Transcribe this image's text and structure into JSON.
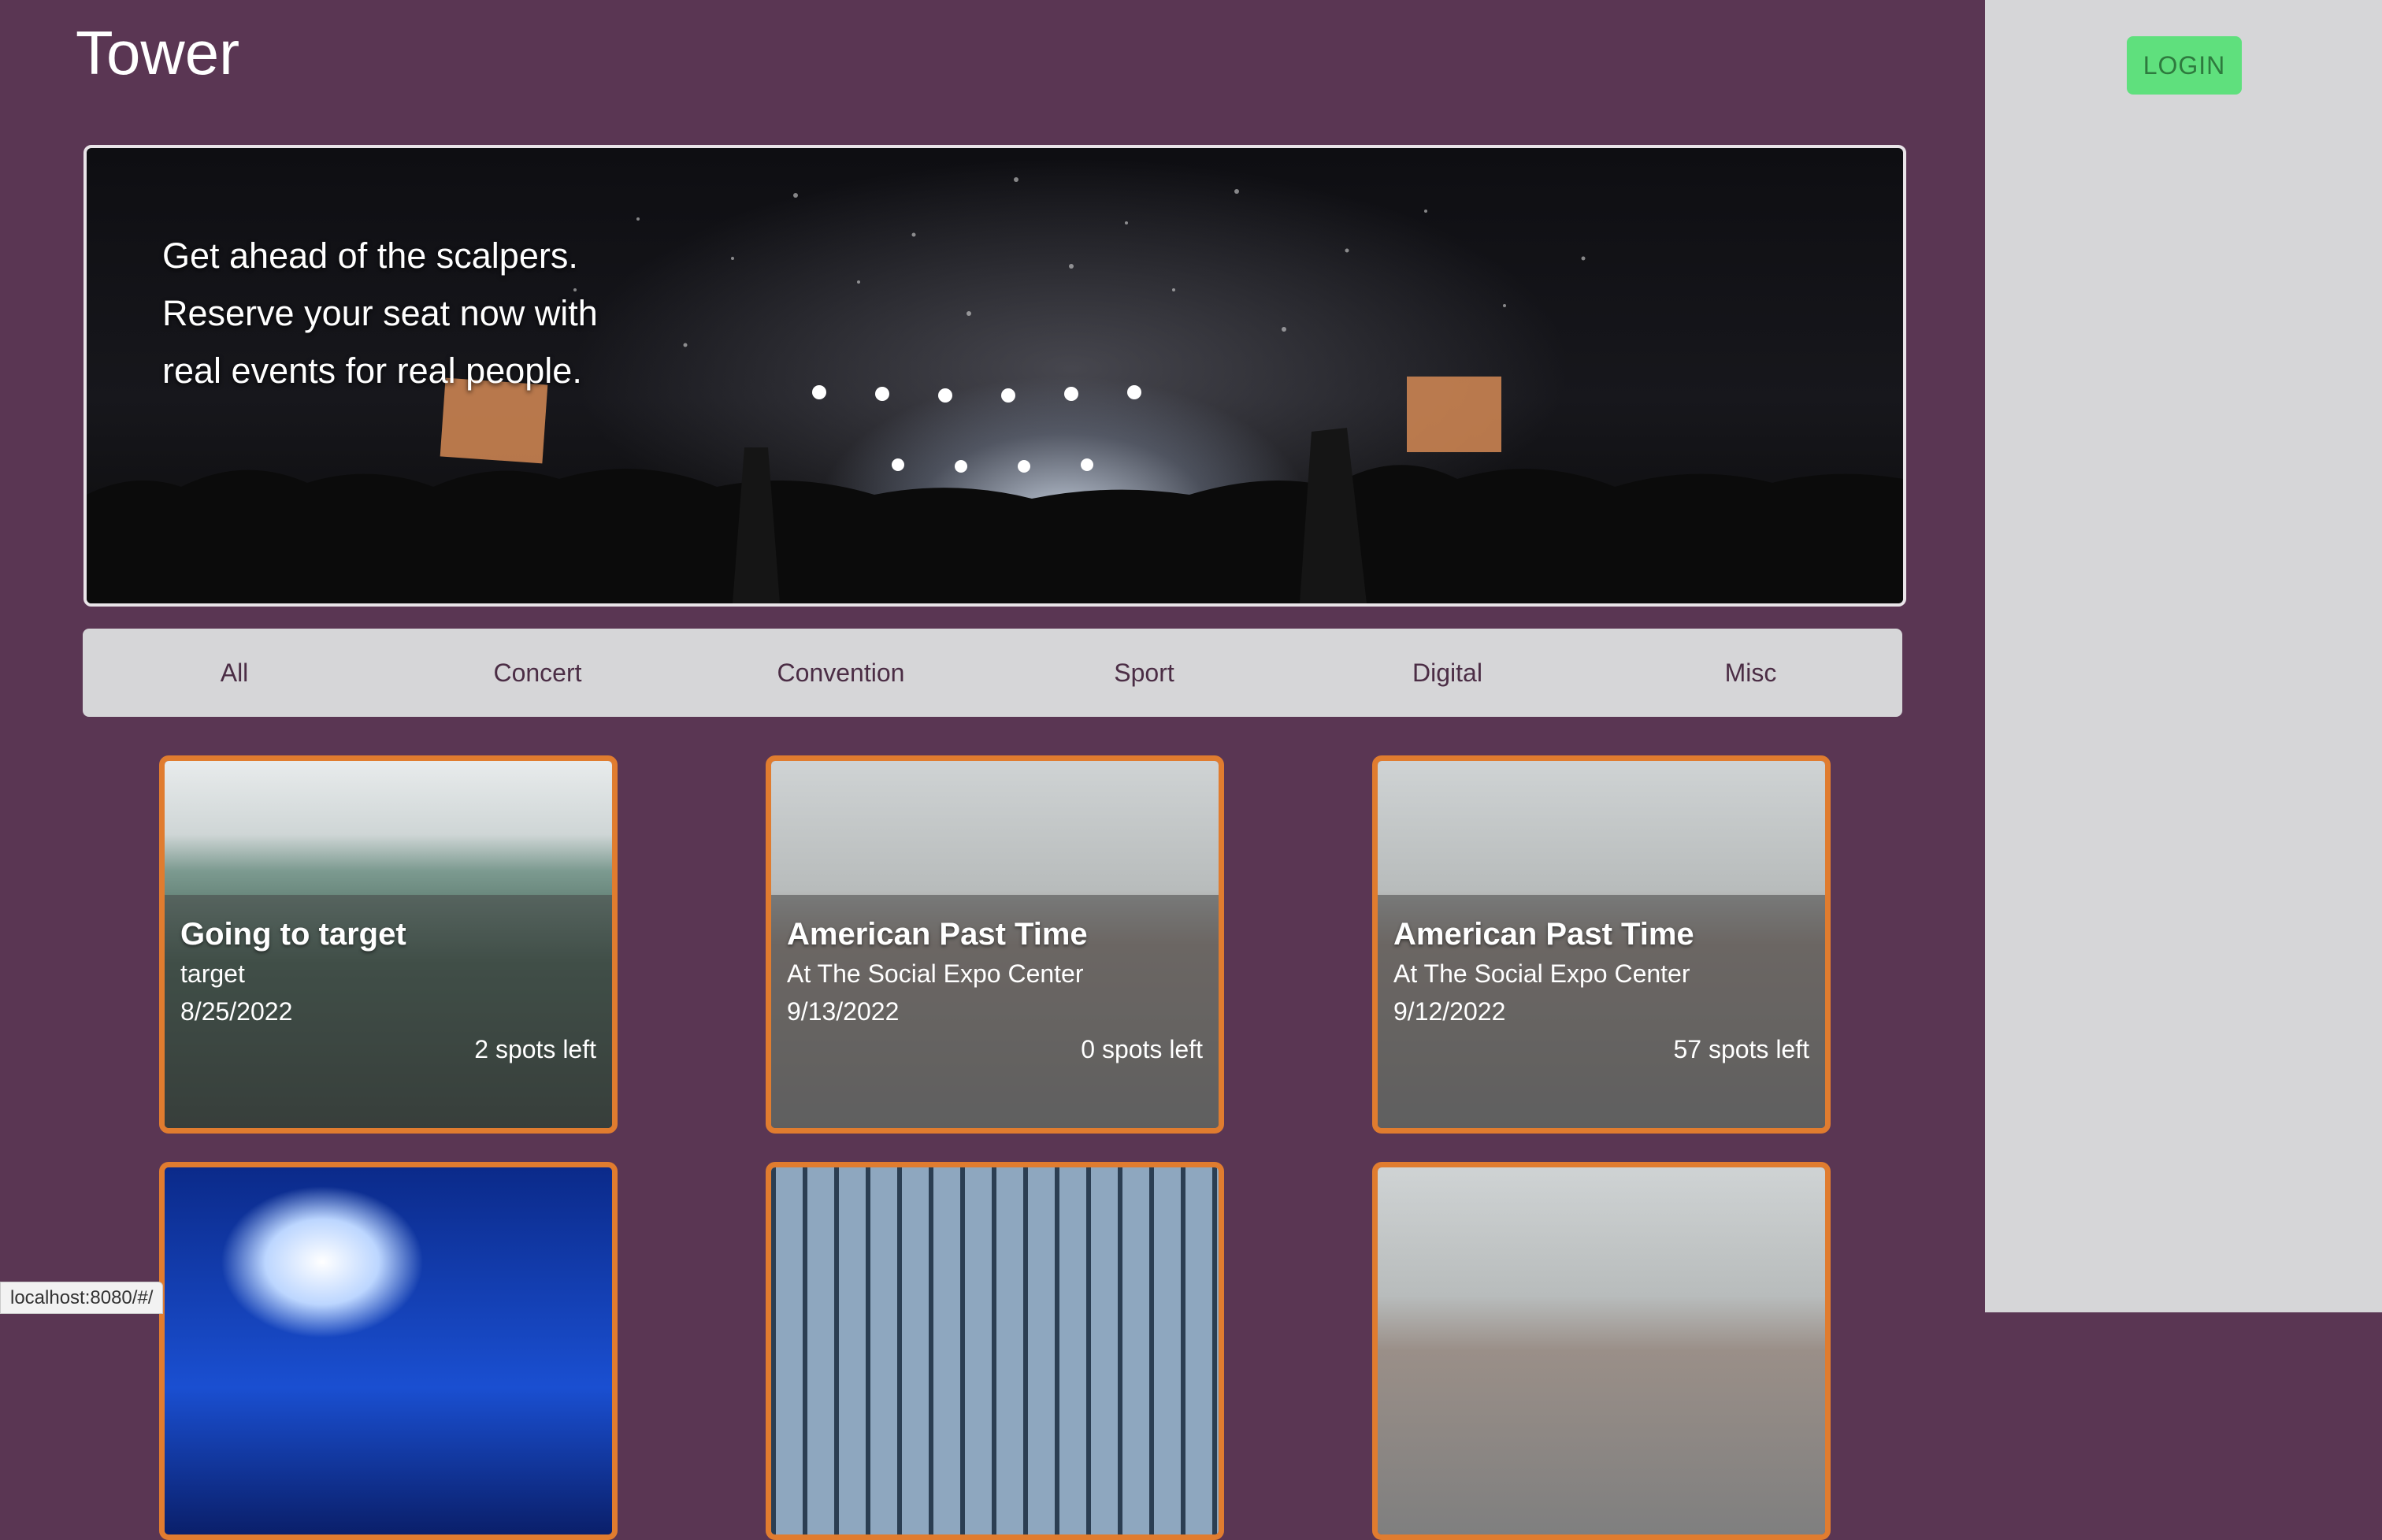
{
  "app": {
    "brand": "Tower"
  },
  "header": {
    "login_label": "LOGIN"
  },
  "hero": {
    "lines": [
      "Get ahead of the scalpers.",
      "Reserve your seat now with",
      "real events for real people."
    ]
  },
  "filters": [
    "All",
    "Concert",
    "Convention",
    "Sport",
    "Digital",
    "Misc"
  ],
  "events": [
    {
      "title": "Going to target",
      "location": "target",
      "date": "8/25/2022",
      "spots": "2 spots left",
      "image": "forest"
    },
    {
      "title": "American Past Time",
      "location": "At The Social Expo Center",
      "date": "9/13/2022",
      "spots": "0 spots left",
      "image": "runner"
    },
    {
      "title": "American Past Time",
      "location": "At The Social Expo Center",
      "date": "9/12/2022",
      "spots": "57 spots left",
      "image": "runner"
    },
    {
      "image": "smoke"
    },
    {
      "image": "building"
    },
    {
      "image": "runner"
    }
  ],
  "statusbar": {
    "url": "localhost:8080/#/"
  },
  "colors": {
    "page_bg": "#5a3653",
    "sidebar_bg": "#d6d6d8",
    "card_border": "#e07c2f",
    "login_bg": "#5fe07d"
  }
}
